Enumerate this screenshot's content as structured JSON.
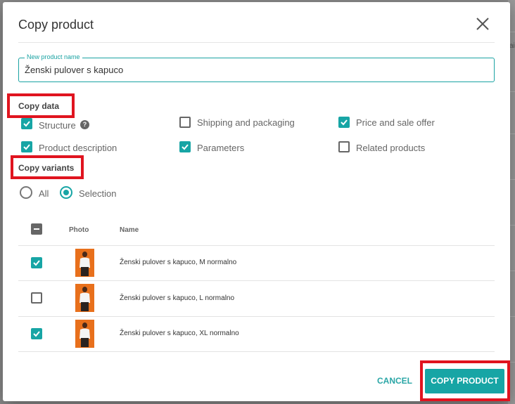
{
  "dialog": {
    "title": "Copy product",
    "close_icon": "close-icon"
  },
  "name_field": {
    "label": "New product name",
    "value": "Ženski pulover s kapuco"
  },
  "copy_data": {
    "heading": "Copy data",
    "options": [
      {
        "label": "Structure",
        "checked": true,
        "help": true
      },
      {
        "label": "Shipping and packaging",
        "checked": false
      },
      {
        "label": "Price and sale offer",
        "checked": true
      },
      {
        "label": "Product description",
        "checked": true
      },
      {
        "label": "Parameters",
        "checked": true
      },
      {
        "label": "Related products",
        "checked": false
      }
    ]
  },
  "copy_variants": {
    "heading": "Copy variants",
    "radios": [
      {
        "label": "All",
        "selected": false
      },
      {
        "label": "Selection",
        "selected": true
      }
    ]
  },
  "table": {
    "columns": [
      "Photo",
      "Name"
    ],
    "select_all_state": "indeterminate",
    "rows": [
      {
        "name": "Ženski pulover s kapuco, M normalno",
        "checked": true
      },
      {
        "name": "Ženski pulover s kapuco, L normalno",
        "checked": false
      },
      {
        "name": "Ženski pulover s kapuco, XL normalno",
        "checked": true
      }
    ]
  },
  "actions": {
    "cancel": "CANCEL",
    "copy": "COPY PRODUCT"
  },
  "colors": {
    "accent": "#17a5a5",
    "highlight": "#e0141f"
  },
  "background": {
    "edge_text": "ai"
  }
}
